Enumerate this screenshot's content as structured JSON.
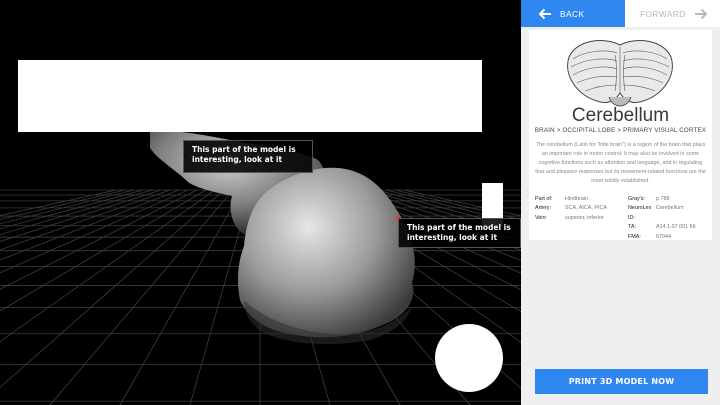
{
  "viewport": {
    "callouts": [
      {
        "text": "This part of the model is interesting, look at it"
      },
      {
        "text": "This part of the model is interesting, look at it"
      }
    ]
  },
  "nav": {
    "back_label": "BACK",
    "forward_label": "FORWARD",
    "back_icon": "arrow-left-icon",
    "forward_icon": "arrow-right-icon"
  },
  "structure": {
    "title": "Cerebellum",
    "breadcrumb": "BRAIN > OCCIPITAL LOBE > PRIMARY VISUAL CORTEX",
    "description": "The cerebellum (Latin for \"little brain\") is a region of the brain that plays an important role in motor control. It may also be involved in some cognitive functions such as attention and language, and in regulating fear and pleasure responses but its movement-related functions are the most solidly established.",
    "facts_left": [
      {
        "key": "Part of:",
        "value": "Hindbrain"
      },
      {
        "key": "Artery:",
        "value": "SCA, AICA, PICA"
      },
      {
        "key": "Vein:",
        "value": "superior, inferior"
      }
    ],
    "facts_right": [
      {
        "key": "Gray's:",
        "value": "p.788"
      },
      {
        "key": "NeuroLex ID:",
        "value": "Cerebellum"
      },
      {
        "key": "TA:",
        "value": "A14.1.07.001 66"
      },
      {
        "key": "FMA:",
        "value": "67944"
      }
    ]
  },
  "actions": {
    "print_label": "PRINT 3D MODEL NOW"
  },
  "colors": {
    "accent": "#2f87ef",
    "panel_bg": "#efefef",
    "viewport_bg": "#000000",
    "marker": "#e33333"
  }
}
